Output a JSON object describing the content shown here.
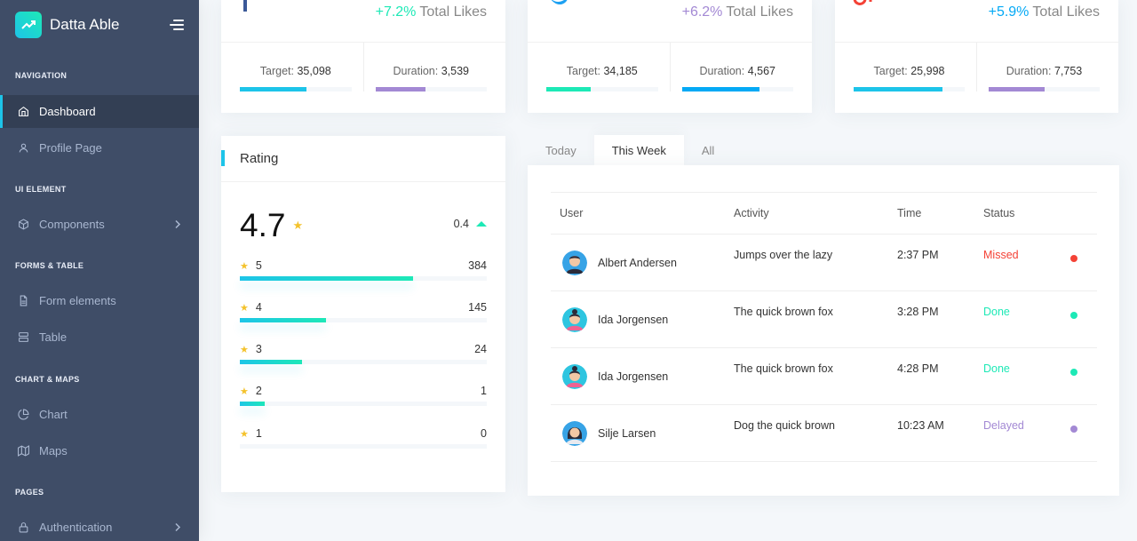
{
  "brand": {
    "name": "Datta Able"
  },
  "sidebar": {
    "sections": [
      {
        "caption": "NAVIGATION",
        "items": [
          {
            "label": "Dashboard",
            "icon": "home-icon",
            "active": true
          },
          {
            "label": "Profile Page",
            "icon": "user-icon"
          }
        ]
      },
      {
        "caption": "UI ELEMENT",
        "items": [
          {
            "label": "Components",
            "icon": "box-icon",
            "arrow": true
          }
        ]
      },
      {
        "caption": "FORMS & TABLE",
        "items": [
          {
            "label": "Form elements",
            "icon": "file-text-icon"
          },
          {
            "label": "Table",
            "icon": "server-icon"
          }
        ]
      },
      {
        "caption": "CHART & MAPS",
        "items": [
          {
            "label": "Chart",
            "icon": "pie-chart-icon"
          },
          {
            "label": "Maps",
            "icon": "map-icon"
          }
        ]
      },
      {
        "caption": "PAGES",
        "items": [
          {
            "label": "Authentication",
            "icon": "lock-icon",
            "arrow": true
          }
        ]
      }
    ]
  },
  "stats": [
    {
      "pct": "+7.2%",
      "pct_color": "#1de9b6",
      "likes_label": "Total Likes",
      "target_label": "Target:",
      "target": "35,098",
      "duration_label": "Duration:",
      "duration": "3,539",
      "target_progress": 0.6,
      "duration_progress": 0.45,
      "target_color": "#1dc4e9",
      "duration_color": "#a389d4",
      "icon": "facebook-icon"
    },
    {
      "pct": "+6.2%",
      "pct_color": "#a389d4",
      "likes_label": "Total Likes",
      "target_label": "Target:",
      "target": "34,185",
      "duration_label": "Duration:",
      "duration": "4,567",
      "target_progress": 0.4,
      "duration_progress": 0.7,
      "target_color": "#1de9b6",
      "duration_color": "#04a9f5",
      "icon": "twitter-icon"
    },
    {
      "pct": "+5.9%",
      "pct_color": "#04a9f5",
      "likes_label": "Total Likes",
      "target_label": "Target:",
      "target": "25,998",
      "duration_label": "Duration:",
      "duration": "7,753",
      "target_progress": 0.8,
      "duration_progress": 0.5,
      "target_color": "#1dc4e9",
      "duration_color": "#a389d4",
      "icon": "google-plus-icon"
    }
  ],
  "rating": {
    "title": "Rating",
    "score": "4.7",
    "delta": "0.4",
    "rows": [
      {
        "stars": "5",
        "count": "384",
        "progress": 0.7
      },
      {
        "stars": "4",
        "count": "145",
        "progress": 0.35
      },
      {
        "stars": "3",
        "count": "24",
        "progress": 0.25
      },
      {
        "stars": "2",
        "count": "1",
        "progress": 0.1
      },
      {
        "stars": "1",
        "count": "0",
        "progress": 0
      }
    ]
  },
  "tabs": [
    {
      "label": "Today"
    },
    {
      "label": "This Week",
      "active": true
    },
    {
      "label": "All"
    }
  ],
  "table": {
    "headers": {
      "user": "User",
      "activity": "Activity",
      "time": "Time",
      "status": "Status"
    },
    "rows": [
      {
        "user": "Albert Andersen",
        "activity": "Jumps over the lazy",
        "time": "2:37 PM",
        "status": "Missed",
        "status_color": "#f44236",
        "avatar": "male"
      },
      {
        "user": "Ida Jorgensen",
        "activity": "The quick brown fox",
        "time": "3:28 PM",
        "status": "Done",
        "status_color": "#1de9b6",
        "avatar": "female"
      },
      {
        "user": "Ida Jorgensen",
        "activity": "The quick brown fox",
        "time": "4:28 PM",
        "status": "Done",
        "status_color": "#1de9b6",
        "avatar": "female"
      },
      {
        "user": "Silje Larsen",
        "activity": "Dog the quick brown",
        "time": "10:23 AM",
        "status": "Delayed",
        "status_color": "#a389d4",
        "avatar": "female2"
      }
    ]
  }
}
